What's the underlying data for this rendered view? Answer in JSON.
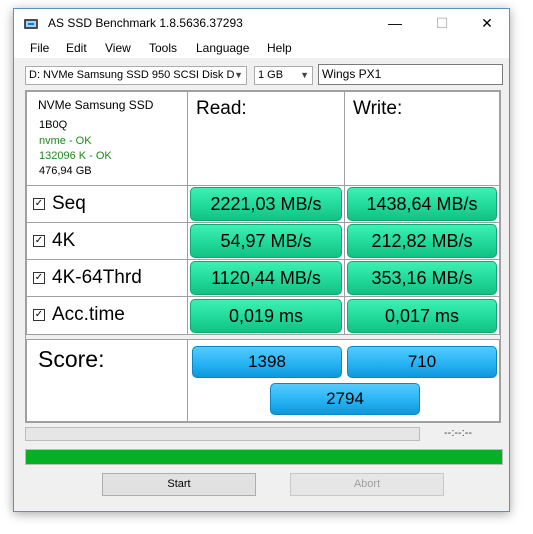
{
  "window": {
    "title": "AS SSD Benchmark 1.8.5636.37293"
  },
  "menu": [
    "File",
    "Edit",
    "View",
    "Tools",
    "Language",
    "Help"
  ],
  "controls": {
    "drive_select": "D: NVMe Samsung SSD 950 SCSI Disk D",
    "size_select": "1 GB",
    "name_field": "Wings PX1"
  },
  "drive_info": {
    "model": "NVMe Samsung SSD",
    "firmware": "1B0Q",
    "driver": "nvme - OK",
    "alignment": "132096 K - OK",
    "capacity": "476,94 GB"
  },
  "columns": {
    "read": "Read:",
    "write": "Write:"
  },
  "tests": [
    {
      "label": "Seq",
      "checked": true,
      "read": "2221,03 MB/s",
      "write": "1438,64 MB/s"
    },
    {
      "label": "4K",
      "checked": true,
      "read": "54,97 MB/s",
      "write": "212,82 MB/s"
    },
    {
      "label": "4K-64Thrd",
      "checked": true,
      "read": "1120,44 MB/s",
      "write": "353,16 MB/s"
    },
    {
      "label": "Acc.time",
      "checked": true,
      "read": "0,019 ms",
      "write": "0,017 ms"
    }
  ],
  "score": {
    "label": "Score:",
    "read": "1398",
    "write": "710",
    "total": "2794"
  },
  "status": {
    "time": "--:--:--",
    "progress_fraction": 1.0
  },
  "buttons": {
    "start": "Start",
    "abort": "Abort"
  },
  "colors": {
    "result_green": "#21d99a",
    "score_blue": "#27b3f3",
    "progress_green": "#06b025"
  }
}
